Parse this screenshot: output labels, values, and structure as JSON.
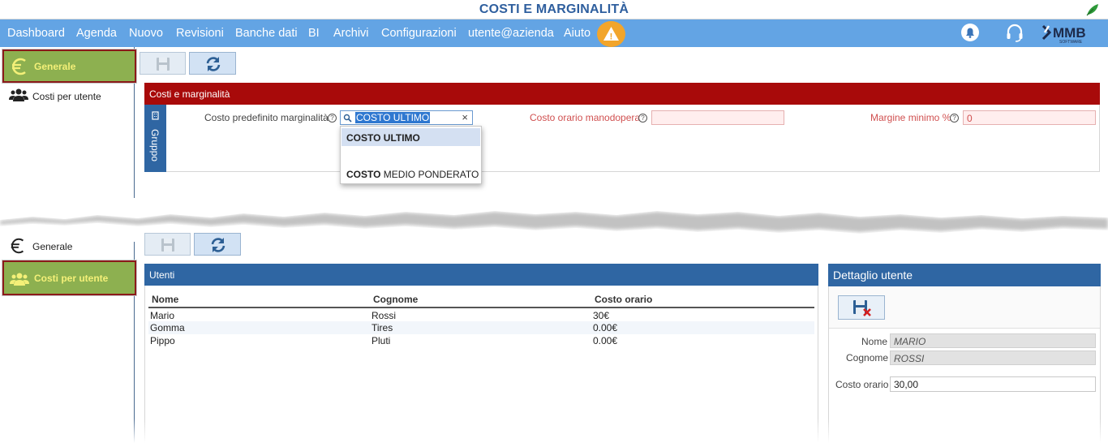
{
  "window": {
    "title": "COSTI E MARGINALITÀ"
  },
  "nav": {
    "items": [
      "Dashboard",
      "Agenda",
      "Nuovo",
      "Revisioni",
      "Banche dati",
      "BI",
      "Archivi",
      "Configurazioni",
      "utente@azienda",
      "Aiuto"
    ],
    "warning_symbol": "!",
    "logo_text": "MMB",
    "logo_sub": "SOFTWARE"
  },
  "sidebar": {
    "top": [
      {
        "label": "Generale",
        "icon": "euro-icon",
        "active": true
      },
      {
        "label": "Costi per utente",
        "icon": "users-icon",
        "active": false
      }
    ],
    "bottom": [
      {
        "label": "Generale",
        "icon": "euro-icon",
        "active": false
      },
      {
        "label": "Costi per utente",
        "icon": "users-icon",
        "active": true
      }
    ]
  },
  "costi": {
    "title": "Costi e marginalità",
    "group_tab": "Gruppo",
    "field1_label": "Costo predefinito marginalità",
    "field1_value": "COSTO ULTIMO",
    "field2_label": "Costo orario manodopera",
    "field2_value": "",
    "field3_label": "Margine minimo %",
    "field3_value": "0",
    "dropdown": [
      {
        "bold": "COSTO ULTIMO",
        "rest": ""
      },
      {
        "bold": "COSTO",
        "rest": " MEDIO PONDERATO"
      }
    ]
  },
  "utenti": {
    "title": "Utenti",
    "columns": [
      "Nome",
      "Cognome",
      "Costo orario"
    ],
    "rows": [
      [
        "Mario",
        "Rossi",
        "30€"
      ],
      [
        "Gomma",
        "Tires",
        "0.00€"
      ],
      [
        "Pippo",
        "Pluti",
        "0.00€"
      ]
    ]
  },
  "dettaglio": {
    "title": "Dettaglio utente",
    "nome_label": "Nome",
    "nome_value": "MARIO",
    "cognome_label": "Cognome",
    "cognome_value": "ROSSI",
    "costo_label": "Costo orario",
    "costo_value": "30,00"
  },
  "colors": {
    "nav": "#63a4e4",
    "title": "#2f5f9e",
    "red_header": "#a80a0a",
    "blue_header": "#2f66a3",
    "active_sidebar": "#8db050",
    "warning": "#f2a52b"
  }
}
